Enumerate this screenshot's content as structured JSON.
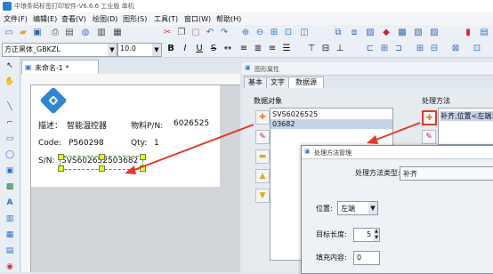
{
  "window": {
    "title": "中琅条码标签打印软件-V6.6.6 工业版 单机"
  },
  "menu": [
    "文件(F)",
    "编辑(E)",
    "查看(V)",
    "绘图(D)",
    "图形(S)",
    "工具(T)",
    "窗口(W)",
    "帮助(H)"
  ],
  "font_toolbar": {
    "font_name": "方正黑体_GBKZL",
    "font_size": "10.0"
  },
  "document": {
    "tab_label": "未命名-1 *"
  },
  "label": {
    "desc_prefix": "描述：",
    "desc_value": "智能温控器",
    "part_prefix": "物料P/N:",
    "part_value": "6026525",
    "code_prefix": "Code:",
    "code_value": "P560298",
    "qty_prefix": "Qty:",
    "qty_value": "1",
    "sn_prefix": "S/N:",
    "sn_value": "SVS602652503682"
  },
  "properties": {
    "title": "图形属性",
    "tabs": [
      "基本",
      "文字",
      "数据源"
    ],
    "data_objects_label": "数据对象",
    "data_objects": [
      "SVS6026525",
      "03682"
    ],
    "process_label": "处理方法",
    "process_item": "补齐,位置<左端>"
  },
  "dialog": {
    "title": "处理方法管理",
    "type_label": "处理方法类型:",
    "type_value": "补齐",
    "position_label": "位置:",
    "position_value": "左端",
    "length_label": "目标长度:",
    "length_value": "5",
    "fill_label": "填充内容:",
    "fill_value": "0"
  },
  "colors": {
    "arrow": "#e23a2a",
    "selection": "#e7ff00",
    "list_highlight": "#c3d4e8"
  }
}
